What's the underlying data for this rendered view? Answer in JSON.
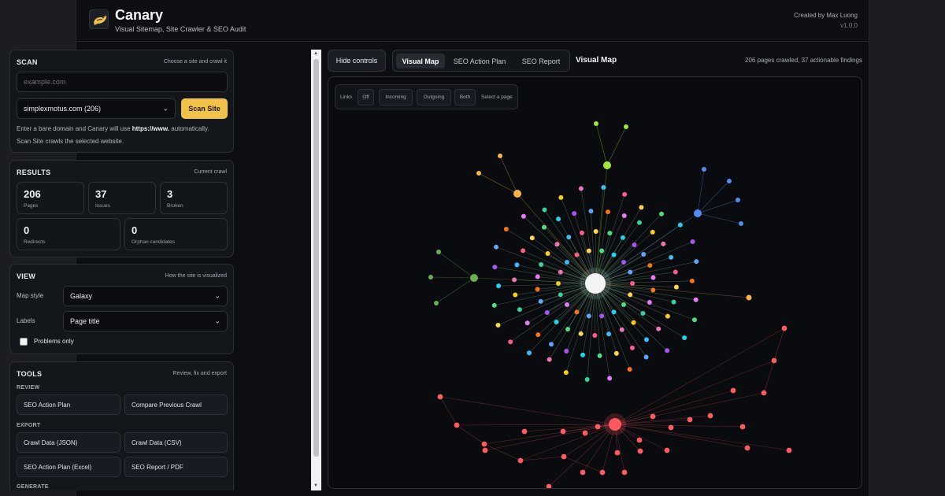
{
  "header": {
    "title": "Canary",
    "subtitle": "Visual Sitemap, Site Crawler & SEO Audit",
    "credit": "Created by Max Luong",
    "version": "v1.0.0"
  },
  "scan": {
    "title": "SCAN",
    "hint": "Choose a site and crawl it",
    "domain_placeholder": "example.com",
    "domain_value": "",
    "selected_site": "simplexmotus.com (206)",
    "scan_button": "Scan Site",
    "help_pre": "Enter a bare domain and Canary will use ",
    "help_bold": "https://www.",
    "help_post": " automatically.",
    "help2": "Scan Site crawls the selected website."
  },
  "results": {
    "title": "RESULTS",
    "hint": "Current crawl",
    "stats": [
      {
        "value": "206",
        "label": "Pages"
      },
      {
        "value": "37",
        "label": "Issues"
      },
      {
        "value": "3",
        "label": "Broken"
      },
      {
        "value": "0",
        "label": "Redirects"
      },
      {
        "value": "0",
        "label": "Orphan candidates"
      }
    ]
  },
  "view": {
    "title": "VIEW",
    "hint": "How the site is visualized",
    "map_style_label": "Map style",
    "map_style_value": "Galaxy",
    "labels_label": "Labels",
    "labels_value": "Page title",
    "problems_only": "Problems only",
    "problems_only_checked": false
  },
  "tools": {
    "title": "TOOLS",
    "hint": "Review, fix and export",
    "review_head": "REVIEW",
    "review": [
      "SEO Action Plan",
      "Compare Previous Crawl"
    ],
    "export_head": "EXPORT",
    "export": [
      "Crawl Data (JSON)",
      "Crawl Data (CSV)",
      "SEO Action Plan (Excel)",
      "SEO Report / PDF"
    ],
    "generate_head": "GENERATE"
  },
  "main": {
    "hide_controls": "Hide controls",
    "tabs": [
      "Visual Map",
      "SEO Action Plan",
      "SEO Report"
    ],
    "active_tab": "Visual Map",
    "view_title": "Visual Map",
    "crawl_note": "206 pages crawled, 37 actionable findings"
  },
  "links_bar": {
    "label": "Links",
    "options": [
      "Off",
      "Incoming",
      "Outgoing",
      "Both"
    ],
    "hint": "Select a page"
  },
  "colors": {
    "accent": "#f2c14a",
    "broken": "#ff5a5f",
    "hub": "#f4f4f4"
  }
}
